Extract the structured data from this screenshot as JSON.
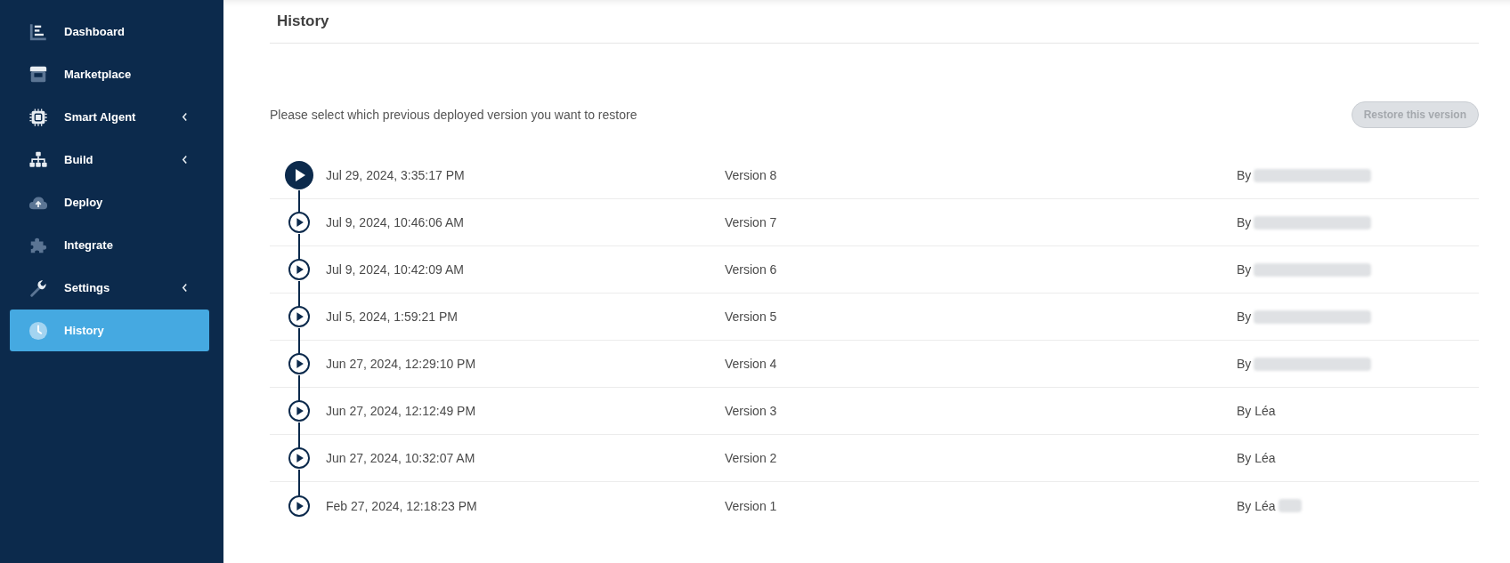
{
  "sidebar": {
    "items": [
      {
        "label": "Dashboard",
        "selected": false,
        "has_submenu": false
      },
      {
        "label": "Marketplace",
        "selected": false,
        "has_submenu": false
      },
      {
        "label": "Smart Algent",
        "selected": false,
        "has_submenu": true
      },
      {
        "label": "Build",
        "selected": false,
        "has_submenu": true
      },
      {
        "label": "Deploy",
        "selected": false,
        "has_submenu": false
      },
      {
        "label": "Integrate",
        "selected": false,
        "has_submenu": false
      },
      {
        "label": "Settings",
        "selected": false,
        "has_submenu": true
      },
      {
        "label": "History",
        "selected": true,
        "has_submenu": false
      }
    ]
  },
  "page": {
    "title": "History",
    "instruction": "Please select which previous deployed version you want to restore",
    "restore_button": {
      "label": "Restore this version",
      "disabled": true
    }
  },
  "versions": [
    {
      "date": "Jul 29, 2024, 3:35:17 PM",
      "version": "Version 8",
      "author": "By",
      "blurred": true,
      "current": true
    },
    {
      "date": "Jul 9, 2024, 10:46:06 AM",
      "version": "Version 7",
      "author": "By",
      "blurred": true,
      "current": false
    },
    {
      "date": "Jul 9, 2024, 10:42:09 AM",
      "version": "Version 6",
      "author": "By",
      "blurred": true,
      "current": false
    },
    {
      "date": "Jul 5, 2024, 1:59:21 PM",
      "version": "Version 5",
      "author": "By",
      "blurred": true,
      "current": false
    },
    {
      "date": "Jun 27, 2024, 12:29:10 PM",
      "version": "Version 4",
      "author": "By",
      "blurred": true,
      "current": false
    },
    {
      "date": "Jun 27, 2024, 12:12:49 PM",
      "version": "Version 3",
      "author": "By Léa",
      "blurred": false,
      "current": false
    },
    {
      "date": "Jun 27, 2024, 10:32:07 AM",
      "version": "Version 2",
      "author": "By Léa",
      "blurred": false,
      "current": false
    },
    {
      "date": "Feb 27, 2024, 12:18:23 PM",
      "version": "Version 1",
      "author": "By Léa",
      "blurred": true,
      "current": false
    }
  ]
}
